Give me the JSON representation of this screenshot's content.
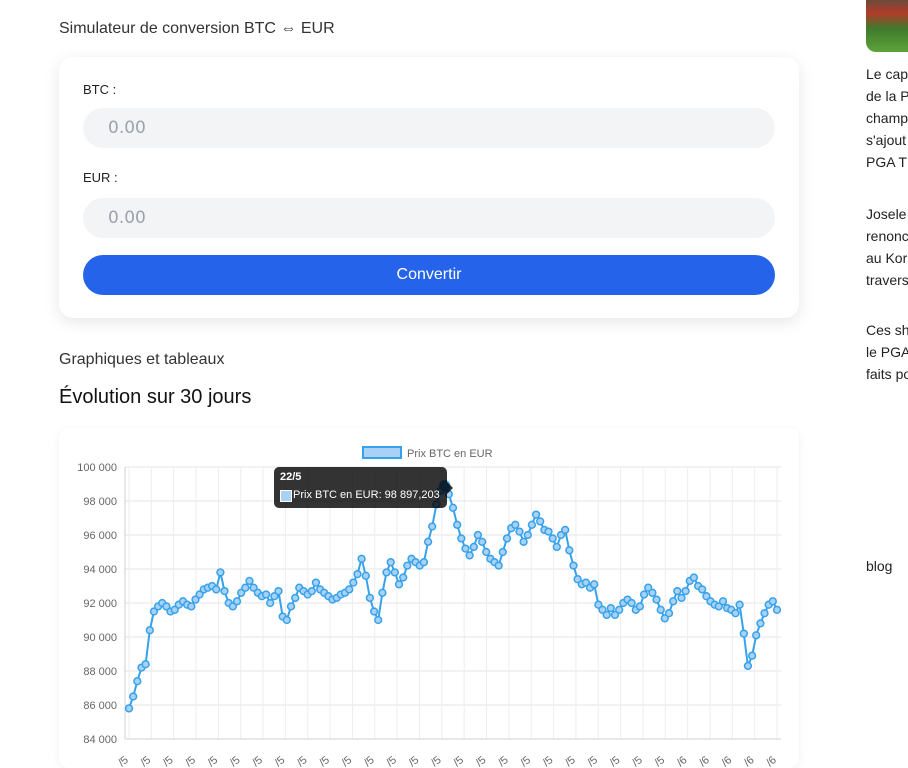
{
  "simulator": {
    "title": "Simulateur de conversion BTC ⇔ EUR",
    "btc_label": "BTC :",
    "btc_placeholder": "0.00",
    "eur_label": "EUR :",
    "eur_placeholder": "0.00",
    "convert_label": "Convertir",
    "button_color": "#2563eb"
  },
  "charts_section": {
    "title": "Graphiques et tableaux",
    "chart_heading": "Évolution sur 30 jours"
  },
  "tooltip": {
    "title": "22/5",
    "body": "Prix BTC en EUR: 98 897,203"
  },
  "sidebar": {
    "paragraphs": [
      [
        "Le cap",
        "de la P",
        "champ",
        "s'ajout",
        "PGA T"
      ],
      [
        "Josele",
        "renonc",
        "au Kor",
        "travers"
      ],
      [
        "Ces sh",
        "le PGA",
        "faits po"
      ]
    ],
    "blog_label": "blog"
  },
  "chart_data": {
    "type": "line",
    "series": [
      {
        "name": "Prix BTC en EUR",
        "color": "#36a2eb",
        "fill": "#a8d1f5",
        "values": [
          85800,
          86500,
          87400,
          88200,
          88400,
          90400,
          91500,
          91800,
          92000,
          91800,
          91500,
          91600,
          91900,
          92100,
          91900,
          91800,
          92200,
          92500,
          92800,
          92900,
          93000,
          92800,
          93800,
          92700,
          92000,
          91800,
          92100,
          92600,
          92900,
          93300,
          92900,
          92600,
          92400,
          92500,
          92000,
          92400,
          92700,
          91200,
          91000,
          91800,
          92300,
          92900,
          92700,
          92500,
          92700,
          93200,
          92800,
          92600,
          92400,
          92200,
          92300,
          92500,
          92600,
          92800,
          93200,
          93700,
          94600,
          93600,
          92300,
          91500,
          91000,
          92600,
          93800,
          94400,
          93800,
          93100,
          93500,
          94200,
          94600,
          94400,
          94200,
          94400,
          95600,
          96500,
          97800,
          98600,
          98900,
          98400,
          97600,
          96600,
          95800,
          95200,
          94800,
          95300,
          96000,
          95600,
          95000,
          94600,
          94400,
          94200,
          95000,
          95800,
          96400,
          96600,
          96200,
          95600,
          96000,
          96600,
          97200,
          96800,
          96300,
          96200,
          95800,
          95300,
          96000,
          96300,
          95100,
          94200,
          93400,
          93100,
          93200,
          92900,
          93100,
          91900,
          91600,
          91300,
          91700,
          91300,
          91600,
          92000,
          92200,
          92000,
          91600,
          91800,
          92500,
          92900,
          92600,
          92200,
          91600,
          91100,
          91400,
          92100,
          92700,
          92300,
          92700,
          93300,
          93500,
          93000,
          92800,
          92400,
          92100,
          91900,
          91800,
          92100,
          91700,
          91600,
          91400,
          91900,
          90200,
          88300,
          88900,
          90100,
          90800,
          91400,
          91900,
          92100,
          91600
        ],
        "highlight_index": 76
      }
    ],
    "x_tick_labels": [
      "/5",
      "/5",
      "/5",
      "/5",
      "/5",
      "/5",
      "/5",
      "/5",
      "/5",
      "/5",
      "/5",
      "/5",
      "/5",
      "/5",
      "/5",
      "/5",
      "/5",
      "/5",
      "/5",
      "/5",
      "/5",
      "/5",
      "/5",
      "/5",
      "/5",
      "/6",
      "/6",
      "/6",
      "/6",
      "/6"
    ],
    "y_tick_labels": [
      "100 000",
      "98 000",
      "96 000",
      "94 000",
      "92 000",
      "90 000",
      "88 000",
      "86 000",
      "84 000"
    ],
    "ylim": [
      84000,
      100000
    ],
    "grid": true,
    "legend": "top-center"
  }
}
